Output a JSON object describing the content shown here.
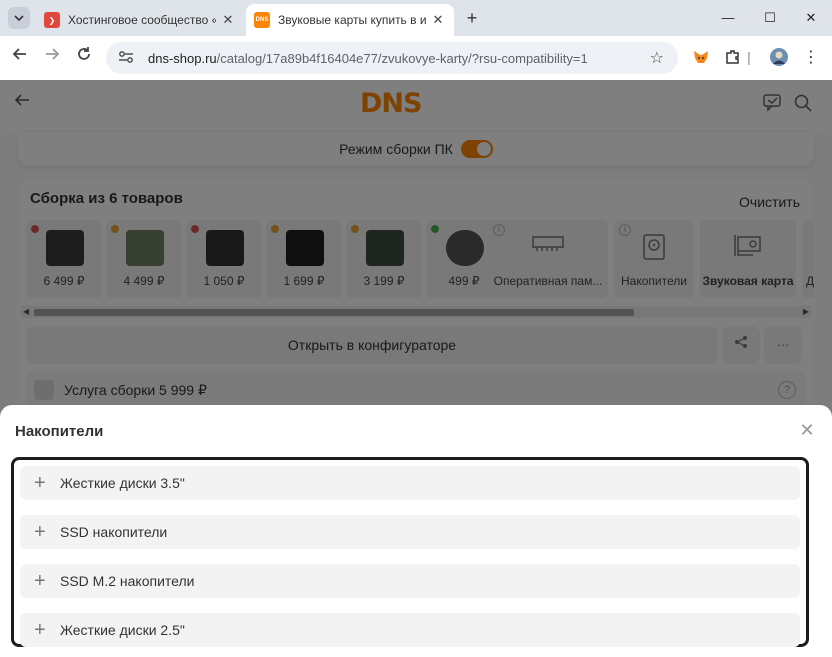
{
  "browser": {
    "tabs": [
      {
        "title": "Хостинговое сообщество «Tim",
        "favicon_color": "#e1473d",
        "favicon_glyph": "❯",
        "close": "✕"
      },
      {
        "title": "Звуковые карты купить в инте",
        "favicon_color": "#fc8507",
        "favicon_glyph": "DNS",
        "close": "✕"
      }
    ],
    "new_tab": "+",
    "address": {
      "host": "dns-shop.ru",
      "path": "/catalog/17a89b4f16404e77/zvukovye-karty/?rsu-compatibility=1"
    },
    "window_controls": {
      "minimize": "—",
      "maximize": "☐",
      "close": "✕"
    }
  },
  "page": {
    "logo_text": "DNS",
    "build_mode_label": "Режим сборки ПК",
    "build_title": "Сборка из 6 товаров",
    "clear_label": "Очистить",
    "items": [
      {
        "price": "6 499 ₽",
        "status_color": "#e05252",
        "thumb_color": "#3a3a3a"
      },
      {
        "price": "4 499 ₽",
        "status_color": "#e8a33a",
        "thumb_color": "#6e7f61"
      },
      {
        "price": "1 050 ₽",
        "status_color": "#e05252",
        "thumb_color": "#333333"
      },
      {
        "price": "1 699 ₽",
        "status_color": "#e8a33a",
        "thumb_color": "#1e1e1e"
      },
      {
        "price": "3 199 ₽",
        "status_color": "#e8a33a",
        "thumb_color": "#3f4a3f"
      },
      {
        "price": "499 ₽",
        "status_color": "#4caf50",
        "thumb_color": "#555555"
      }
    ],
    "categories": [
      {
        "label": "Оперативная пам...",
        "icon": "ram-icon"
      },
      {
        "label": "Накопители",
        "icon": "disk-icon"
      },
      {
        "label": "Звуковая карта",
        "icon": "soundcard-icon"
      },
      {
        "label": "Дог",
        "icon": ""
      }
    ],
    "configurator_label": "Открыть в конфигураторе",
    "service_label": "Услуга сборки 5 999 ₽"
  },
  "modal": {
    "title": "Накопители",
    "items": [
      {
        "label": "Жесткие диски 3.5\""
      },
      {
        "label": "SSD накопители"
      },
      {
        "label": "SSD M.2 накопители"
      },
      {
        "label": "Жесткие диски 2.5\""
      }
    ]
  }
}
